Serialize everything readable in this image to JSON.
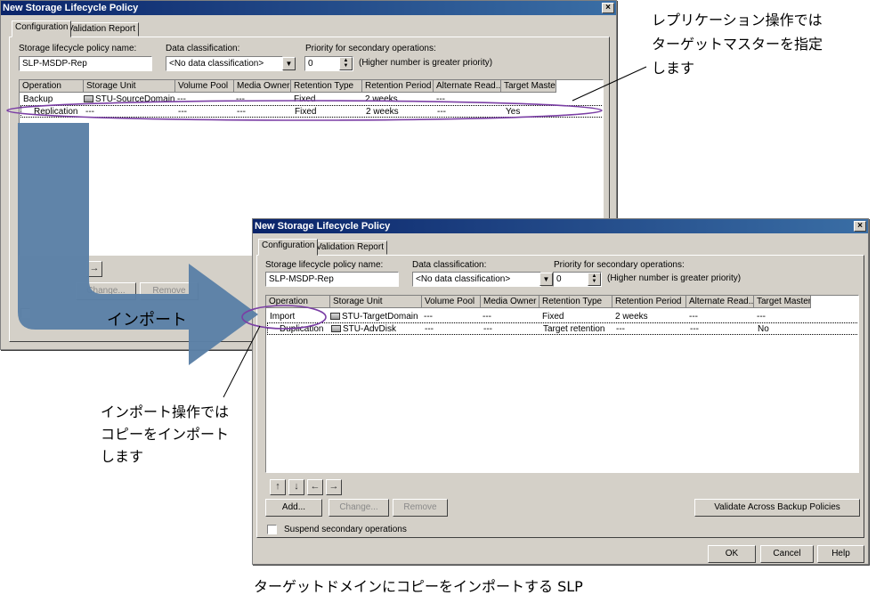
{
  "back_window": {
    "title": "New Storage Lifecycle Policy",
    "close_glyph": "×",
    "tabs": [
      "Configuration",
      "Validation Report"
    ],
    "policy_name_label": "Storage lifecycle policy name:",
    "policy_name_value": "SLP-MSDP-Rep",
    "classification_label": "Data classification:",
    "classification_value": "<No data classification>",
    "priority_label": "Priority for secondary operations:",
    "priority_value": "0",
    "priority_hint": "(Higher number is greater priority)",
    "columns": [
      "Operation",
      "Storage Unit",
      "Volume Pool",
      "Media Owner",
      "Retention Type",
      "Retention Period",
      "Alternate Read...",
      "Target Master"
    ],
    "rows": [
      [
        "Backup",
        "STU-SourceDomain",
        "---",
        "---",
        "Fixed",
        "2 weeks",
        "---",
        ""
      ],
      [
        "Replication",
        "---",
        "---",
        "---",
        "Fixed",
        "2 weeks",
        "---",
        "Yes"
      ]
    ],
    "change_label": "Change...",
    "remove_label": "Remove"
  },
  "front_window": {
    "title": "New Storage Lifecycle Policy",
    "close_glyph": "×",
    "tabs": [
      "Configuration",
      "Validation Report"
    ],
    "policy_name_label": "Storage lifecycle policy name:",
    "policy_name_value": "SLP-MSDP-Rep",
    "classification_label": "Data classification:",
    "classification_value": "<No data classification>",
    "priority_label": "Priority for secondary operations:",
    "priority_value": "0",
    "priority_hint": "(Higher number is greater priority)",
    "columns": [
      "Operation",
      "Storage Unit",
      "Volume Pool",
      "Media Owner",
      "Retention Type",
      "Retention Period",
      "Alternate Read...",
      "Target Master"
    ],
    "rows": [
      [
        "Import",
        "STU-TargetDomain",
        "---",
        "---",
        "Fixed",
        "2 weeks",
        "---",
        "---"
      ],
      [
        "Duplication",
        "STU-AdvDisk",
        "---",
        "---",
        "Target retention",
        "---",
        "---",
        "No"
      ]
    ],
    "arrow_buttons": [
      "↑",
      "↓",
      "←",
      "→"
    ],
    "add_label": "Add...",
    "change_label": "Change...",
    "remove_label": "Remove",
    "validate_label": "Validate Across Backup Policies",
    "suspend_label": "Suspend secondary operations",
    "ok_label": "OK",
    "cancel_label": "Cancel",
    "help_label": "Help"
  },
  "callouts": {
    "replication_note": [
      "レプリケーション操作では",
      "ターゲットマスターを指定",
      "します"
    ],
    "import_arrow_label": "インポート",
    "import_note": [
      "インポート操作では",
      "コピーをインポート",
      "します"
    ],
    "caption": "ターゲットドメインにコピーをインポートする SLP"
  },
  "colors": {
    "highlight_ellipse": "#7b3fa5",
    "arrow_fill": "#5b80a6",
    "title_bar": "#0a246a",
    "dialog_face": "#d4d0c8"
  }
}
